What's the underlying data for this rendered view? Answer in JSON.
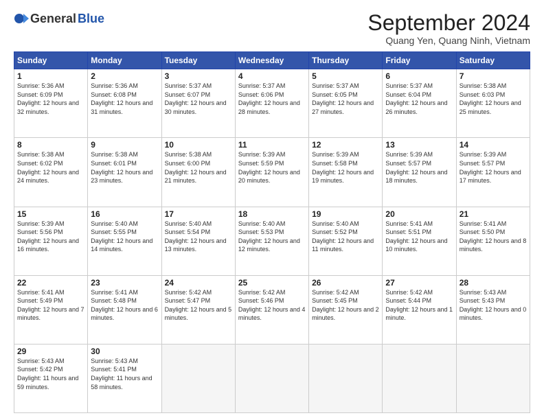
{
  "logo": {
    "general": "General",
    "blue": "Blue"
  },
  "title": "September 2024",
  "location": "Quang Yen, Quang Ninh, Vietnam",
  "days_of_week": [
    "Sunday",
    "Monday",
    "Tuesday",
    "Wednesday",
    "Thursday",
    "Friday",
    "Saturday"
  ],
  "weeks": [
    [
      {
        "day": "1",
        "sunrise": "5:36 AM",
        "sunset": "6:09 PM",
        "daylight": "12 hours and 32 minutes."
      },
      {
        "day": "2",
        "sunrise": "5:36 AM",
        "sunset": "6:08 PM",
        "daylight": "12 hours and 31 minutes."
      },
      {
        "day": "3",
        "sunrise": "5:37 AM",
        "sunset": "6:07 PM",
        "daylight": "12 hours and 30 minutes."
      },
      {
        "day": "4",
        "sunrise": "5:37 AM",
        "sunset": "6:06 PM",
        "daylight": "12 hours and 28 minutes."
      },
      {
        "day": "5",
        "sunrise": "5:37 AM",
        "sunset": "6:05 PM",
        "daylight": "12 hours and 27 minutes."
      },
      {
        "day": "6",
        "sunrise": "5:37 AM",
        "sunset": "6:04 PM",
        "daylight": "12 hours and 26 minutes."
      },
      {
        "day": "7",
        "sunrise": "5:38 AM",
        "sunset": "6:03 PM",
        "daylight": "12 hours and 25 minutes."
      }
    ],
    [
      {
        "day": "8",
        "sunrise": "5:38 AM",
        "sunset": "6:02 PM",
        "daylight": "12 hours and 24 minutes."
      },
      {
        "day": "9",
        "sunrise": "5:38 AM",
        "sunset": "6:01 PM",
        "daylight": "12 hours and 23 minutes."
      },
      {
        "day": "10",
        "sunrise": "5:38 AM",
        "sunset": "6:00 PM",
        "daylight": "12 hours and 21 minutes."
      },
      {
        "day": "11",
        "sunrise": "5:39 AM",
        "sunset": "5:59 PM",
        "daylight": "12 hours and 20 minutes."
      },
      {
        "day": "12",
        "sunrise": "5:39 AM",
        "sunset": "5:58 PM",
        "daylight": "12 hours and 19 minutes."
      },
      {
        "day": "13",
        "sunrise": "5:39 AM",
        "sunset": "5:57 PM",
        "daylight": "12 hours and 18 minutes."
      },
      {
        "day": "14",
        "sunrise": "5:39 AM",
        "sunset": "5:57 PM",
        "daylight": "12 hours and 17 minutes."
      }
    ],
    [
      {
        "day": "15",
        "sunrise": "5:39 AM",
        "sunset": "5:56 PM",
        "daylight": "12 hours and 16 minutes."
      },
      {
        "day": "16",
        "sunrise": "5:40 AM",
        "sunset": "5:55 PM",
        "daylight": "12 hours and 14 minutes."
      },
      {
        "day": "17",
        "sunrise": "5:40 AM",
        "sunset": "5:54 PM",
        "daylight": "12 hours and 13 minutes."
      },
      {
        "day": "18",
        "sunrise": "5:40 AM",
        "sunset": "5:53 PM",
        "daylight": "12 hours and 12 minutes."
      },
      {
        "day": "19",
        "sunrise": "5:40 AM",
        "sunset": "5:52 PM",
        "daylight": "12 hours and 11 minutes."
      },
      {
        "day": "20",
        "sunrise": "5:41 AM",
        "sunset": "5:51 PM",
        "daylight": "12 hours and 10 minutes."
      },
      {
        "day": "21",
        "sunrise": "5:41 AM",
        "sunset": "5:50 PM",
        "daylight": "12 hours and 8 minutes."
      }
    ],
    [
      {
        "day": "22",
        "sunrise": "5:41 AM",
        "sunset": "5:49 PM",
        "daylight": "12 hours and 7 minutes."
      },
      {
        "day": "23",
        "sunrise": "5:41 AM",
        "sunset": "5:48 PM",
        "daylight": "12 hours and 6 minutes."
      },
      {
        "day": "24",
        "sunrise": "5:42 AM",
        "sunset": "5:47 PM",
        "daylight": "12 hours and 5 minutes."
      },
      {
        "day": "25",
        "sunrise": "5:42 AM",
        "sunset": "5:46 PM",
        "daylight": "12 hours and 4 minutes."
      },
      {
        "day": "26",
        "sunrise": "5:42 AM",
        "sunset": "5:45 PM",
        "daylight": "12 hours and 2 minutes."
      },
      {
        "day": "27",
        "sunrise": "5:42 AM",
        "sunset": "5:44 PM",
        "daylight": "12 hours and 1 minute."
      },
      {
        "day": "28",
        "sunrise": "5:43 AM",
        "sunset": "5:43 PM",
        "daylight": "12 hours and 0 minutes."
      }
    ],
    [
      {
        "day": "29",
        "sunrise": "5:43 AM",
        "sunset": "5:42 PM",
        "daylight": "11 hours and 59 minutes."
      },
      {
        "day": "30",
        "sunrise": "5:43 AM",
        "sunset": "5:41 PM",
        "daylight": "11 hours and 58 minutes."
      },
      null,
      null,
      null,
      null,
      null
    ]
  ]
}
